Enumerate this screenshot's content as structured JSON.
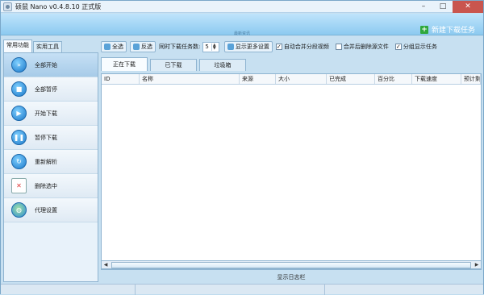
{
  "window": {
    "title": "硕鼠 Nano v0.4.8.10 正式版",
    "controls": [
      "–",
      "□",
      "✕"
    ]
  },
  "ribbon": {
    "label": "最新资讯",
    "new_task": "新建下载任务"
  },
  "left_tabs": [
    "常用功能",
    "实用工具"
  ],
  "sidebar": {
    "items": [
      {
        "label": "全部开始",
        "icon": "fast-forward-icon",
        "glyph": "»"
      },
      {
        "label": "全部暂停",
        "icon": "stop-icon",
        "glyph": "■"
      },
      {
        "label": "开始下载",
        "icon": "play-icon",
        "glyph": "▶"
      },
      {
        "label": "暂停下载",
        "icon": "pause-icon",
        "glyph": "❚❚"
      },
      {
        "label": "重新解析",
        "icon": "refresh-icon",
        "glyph": "↻"
      },
      {
        "label": "删除选中",
        "icon": "delete-doc-icon",
        "glyph": "✕"
      },
      {
        "label": "代理设置",
        "icon": "globe-icon",
        "glyph": "◍"
      }
    ]
  },
  "toolbar": {
    "select_all": "全选",
    "invert": "反选",
    "concurrent_label": "同时下载任务数:",
    "concurrent_value": "5",
    "more_settings": "显示更多设置",
    "auto_merge": "自动合并分段视频",
    "delete_after_merge": "合并后删除源文件",
    "group_display": "分组显示任务"
  },
  "checkboxes": {
    "auto_merge": true,
    "delete_after_merge": false,
    "group_display": true
  },
  "tabs": [
    "正在下载",
    "已下载",
    "垃圾箱"
  ],
  "table": {
    "columns": [
      "ID",
      "名称",
      "来源",
      "大小",
      "已完成",
      "百分比",
      "下载速度",
      "预计剩"
    ]
  },
  "scroll": {
    "left": "◀",
    "right": "▶"
  },
  "log_bar": "显示日志栏",
  "colors": {
    "accent": "#1c78c9",
    "ribbon": "#8ccaf0",
    "new_task_plus": "#2fa83c"
  }
}
